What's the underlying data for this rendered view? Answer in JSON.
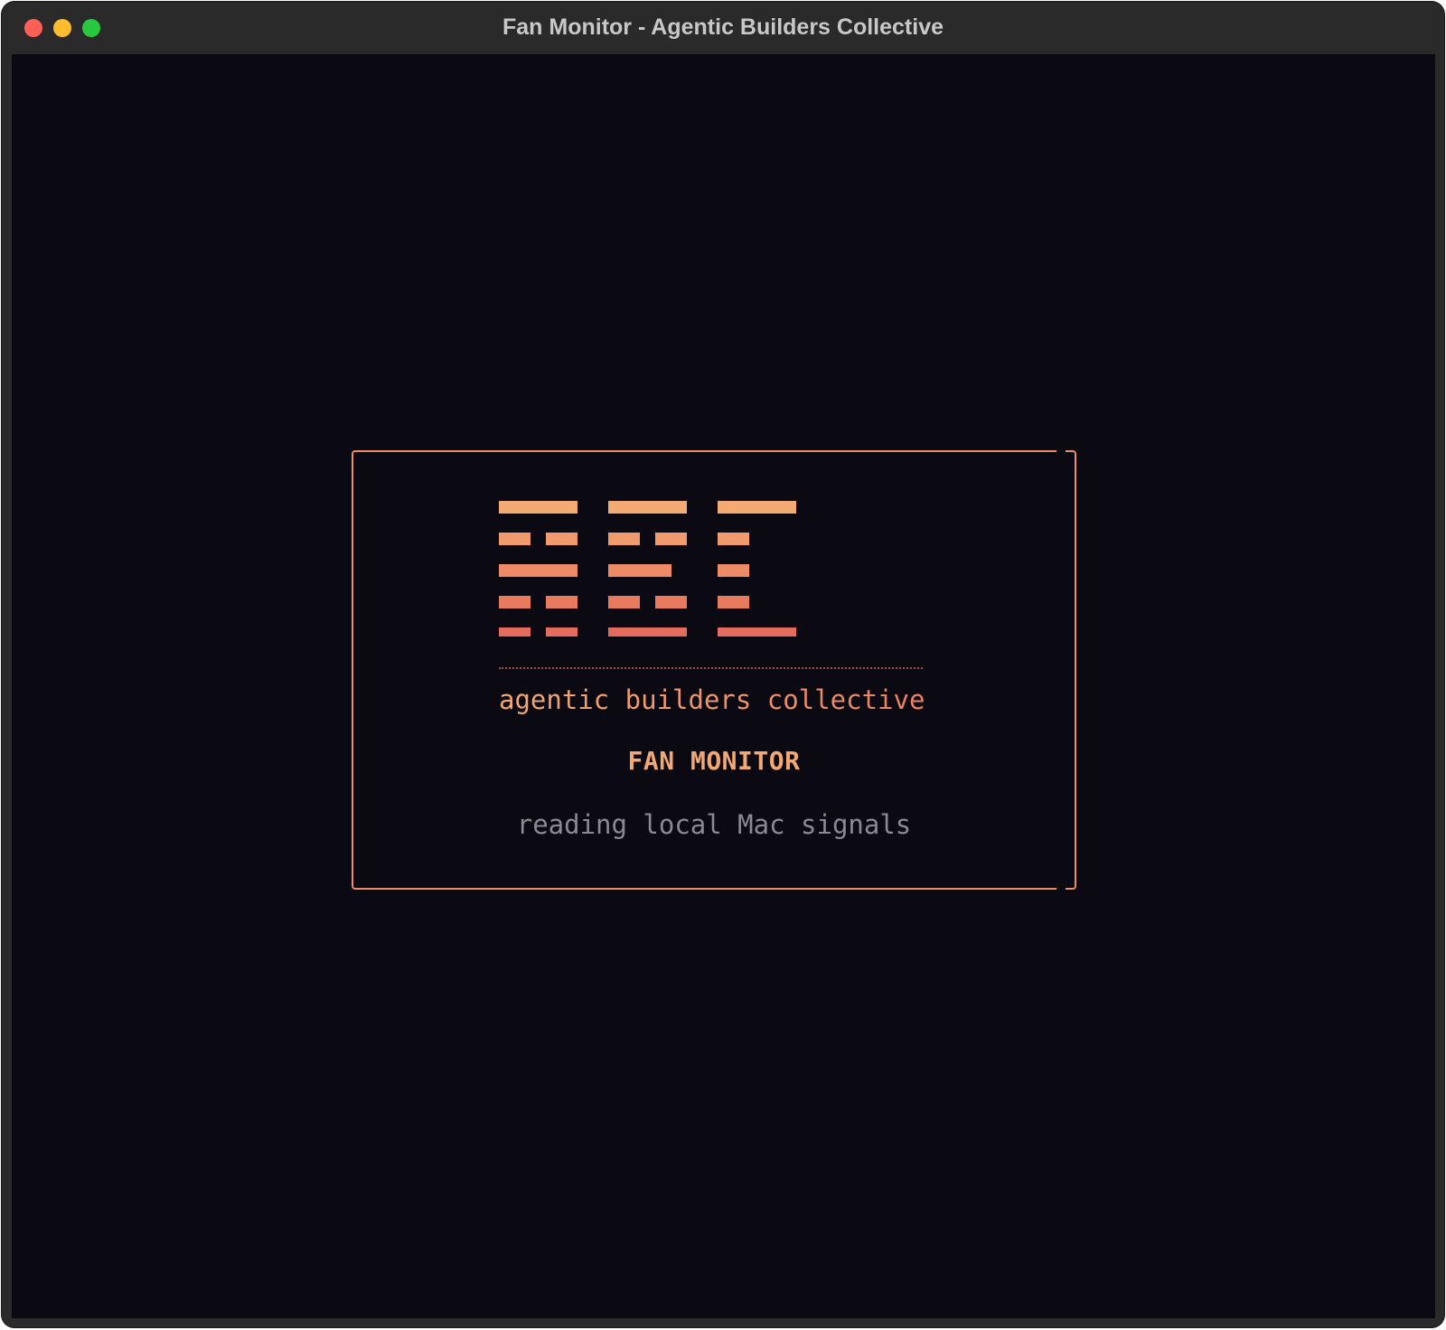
{
  "window": {
    "title": "Fan Monitor - Agentic Builders Collective",
    "controls": [
      {
        "name": "close",
        "color": "#fe5f57"
      },
      {
        "name": "minimize",
        "color": "#febc2e"
      },
      {
        "name": "zoom",
        "color": "#28c840"
      }
    ]
  },
  "splash": {
    "logo_icon": "abc-block-letters-logo",
    "brand": "agentic builders collective",
    "product": "FAN MONITOR",
    "status": "reading local Mac signals"
  },
  "colors": {
    "background": "#0b0a12",
    "border": "#ec8d66",
    "logo_gradient": [
      "#f4aa73",
      "#f19a6b",
      "#ec8b66",
      "#e87a5e",
      "#e56b5c"
    ],
    "product": "#f3a873",
    "status": "#8b8a91"
  }
}
